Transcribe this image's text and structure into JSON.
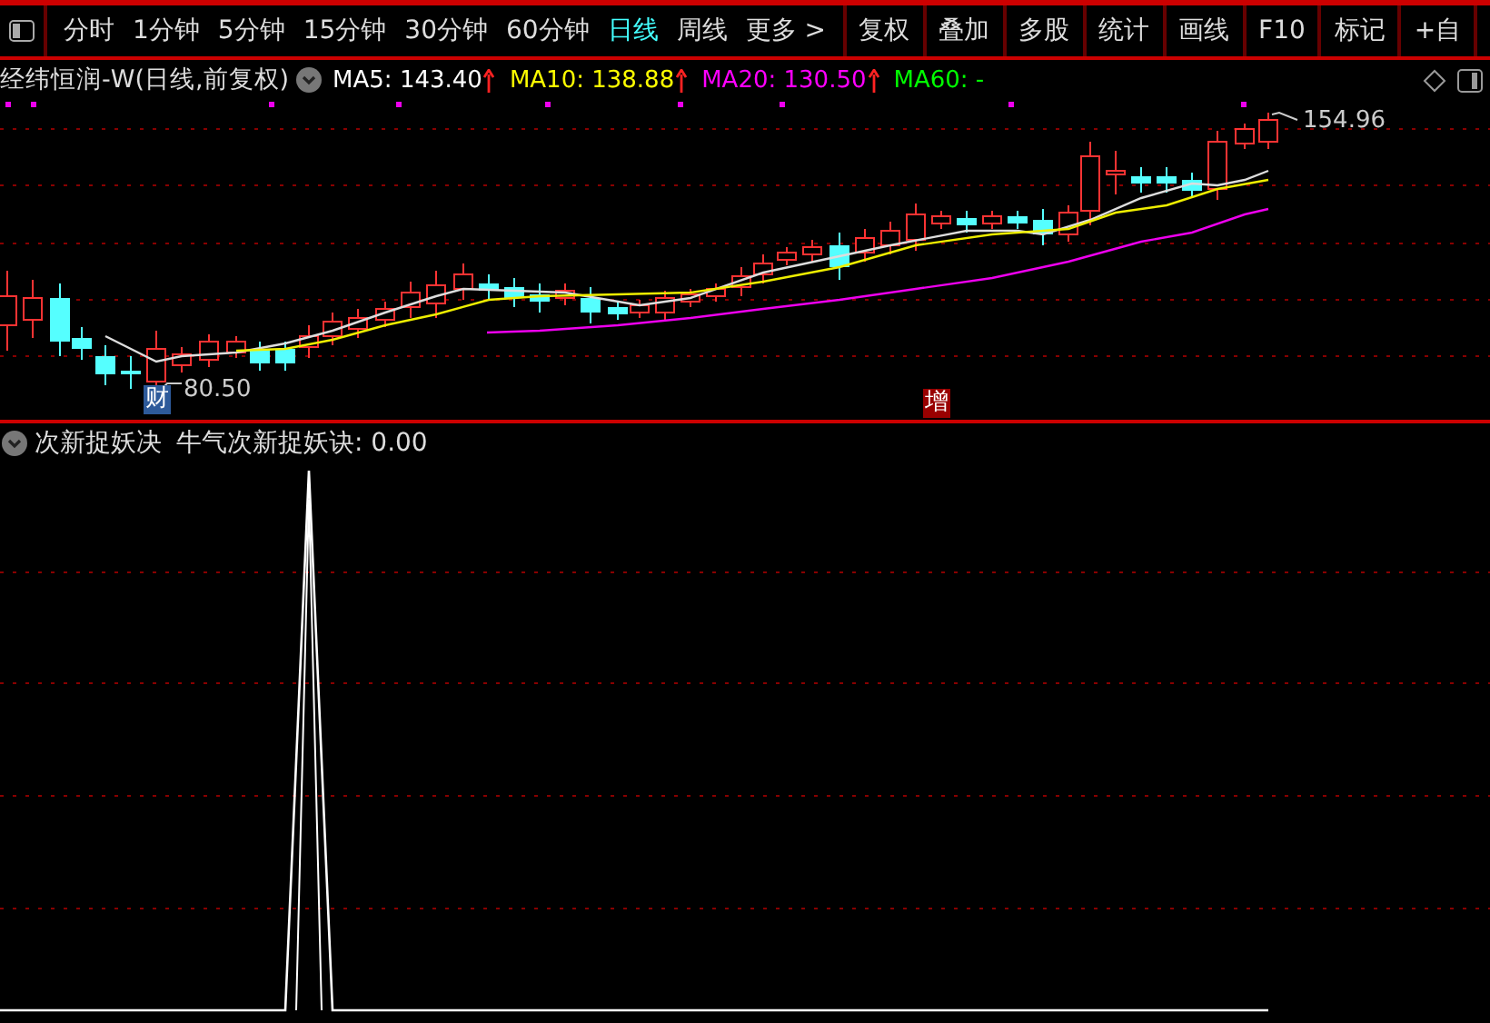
{
  "toolbar": {
    "periods": [
      {
        "label": "分时",
        "selected": false
      },
      {
        "label": "1分钟",
        "selected": false
      },
      {
        "label": "5分钟",
        "selected": false
      },
      {
        "label": "15分钟",
        "selected": false
      },
      {
        "label": "30分钟",
        "selected": false
      },
      {
        "label": "60分钟",
        "selected": false
      },
      {
        "label": "日线",
        "selected": true
      },
      {
        "label": "周线",
        "selected": false
      },
      {
        "label": "更多 >",
        "selected": false
      }
    ],
    "tools": [
      "复权",
      "叠加",
      "多股",
      "统计",
      "画线",
      "F10",
      "标记",
      "+自"
    ]
  },
  "main_chart": {
    "title": "经纬恒润-W(日线,前复权)",
    "moving_averages": [
      {
        "label": "MA5: 143.40",
        "color": "#ffffff",
        "rising": true
      },
      {
        "label": "MA10: 138.88",
        "color": "#ffff00",
        "rising": true
      },
      {
        "label": "MA20: 130.50",
        "color": "#ff00ff",
        "rising": true
      },
      {
        "label": "MA60: -",
        "color": "#00ff00",
        "rising": false
      }
    ],
    "low_price": "80.50",
    "high_price": "154.96",
    "markers": [
      {
        "label": "财",
        "kind": "finance"
      },
      {
        "label": "增",
        "kind": "issue"
      }
    ]
  },
  "indicator": {
    "name": "次新捉妖决",
    "reading": "牛气次新捉妖诀: 0.00"
  }
}
